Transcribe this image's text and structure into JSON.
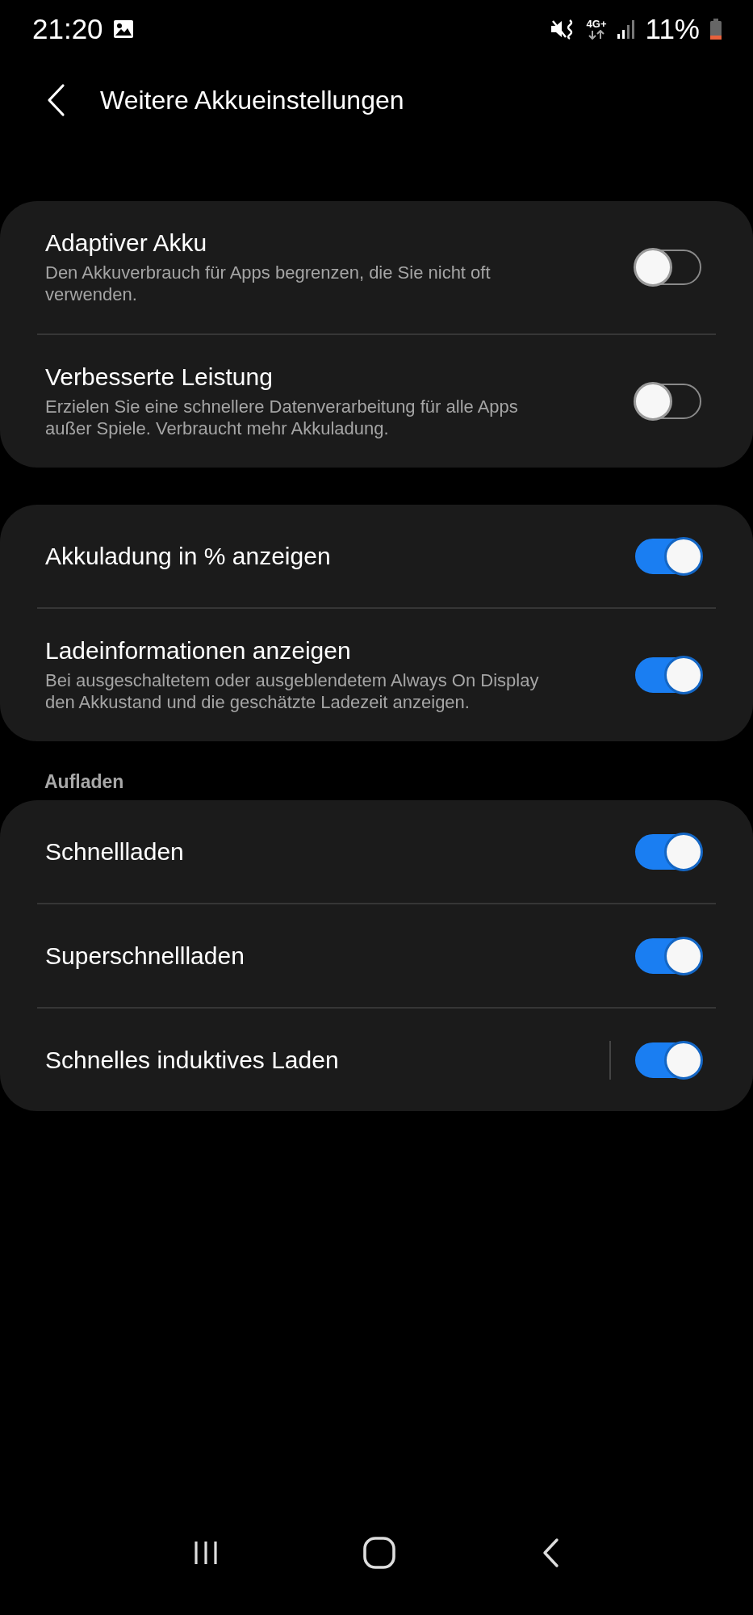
{
  "status_bar": {
    "time": "21:20",
    "network": "4G+",
    "battery": "11%"
  },
  "header": {
    "title": "Weitere Akkueinstellungen"
  },
  "groups": [
    {
      "rows": [
        {
          "title": "Adaptiver Akku",
          "subtitle": "Den Akkuverbrauch für Apps begrenzen, die Sie nicht oft verwenden.",
          "on": false
        },
        {
          "title": "Verbesserte Leistung",
          "subtitle": "Erzielen Sie eine schnellere Datenverarbeitung für alle Apps außer Spiele. Verbraucht mehr Akkuladung.",
          "on": false
        }
      ]
    },
    {
      "rows": [
        {
          "title": "Akkuladung in % anzeigen",
          "on": true
        },
        {
          "title": "Ladeinformationen anzeigen",
          "subtitle": "Bei ausgeschaltetem oder ausgeblendetem Always On Display den Akkustand und die geschätzte Ladezeit anzeigen.",
          "on": true
        }
      ]
    },
    {
      "label": "Aufladen",
      "rows": [
        {
          "title": "Schnellladen",
          "on": true
        },
        {
          "title": "Superschnellladen",
          "on": true
        },
        {
          "title": "Schnelles induktives Laden",
          "on": true,
          "separator": true
        }
      ]
    }
  ]
}
